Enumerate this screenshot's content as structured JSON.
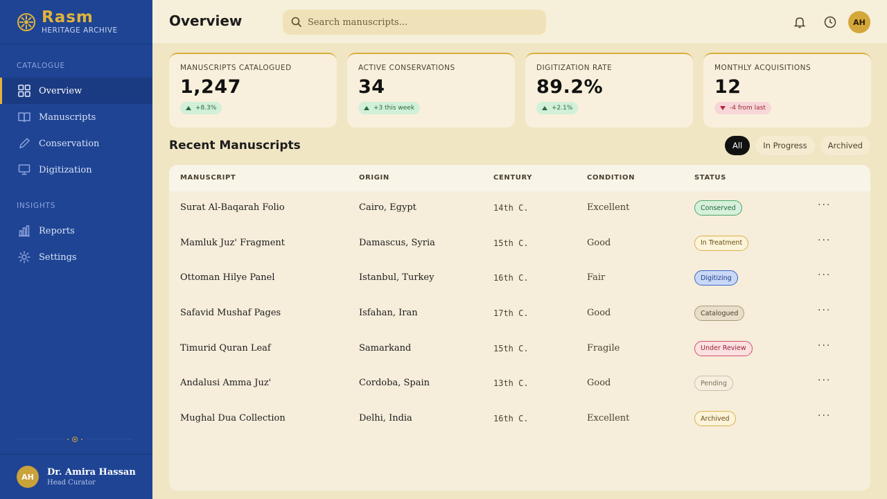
{
  "brand": {
    "name": "Rasm",
    "subtitle": "HERITAGE ARCHIVE"
  },
  "sidebar": {
    "sections": [
      {
        "label": "CATALOGUE",
        "items": [
          {
            "label": "Overview",
            "icon": "grid-icon",
            "active": true
          },
          {
            "label": "Manuscripts",
            "icon": "book-icon"
          },
          {
            "label": "Conservation",
            "icon": "pen-icon"
          },
          {
            "label": "Digitization",
            "icon": "monitor-icon"
          }
        ]
      },
      {
        "label": "INSIGHTS",
        "items": [
          {
            "label": "Reports",
            "icon": "bar-chart-icon"
          },
          {
            "label": "Settings",
            "icon": "gear-icon"
          }
        ]
      }
    ],
    "user": {
      "initials": "AH",
      "name": "Dr. Amira Hassan",
      "role": "Head Curator"
    }
  },
  "header": {
    "title": "Overview",
    "search_placeholder": "Search manuscripts...",
    "avatar_initials": "AH"
  },
  "stats": [
    {
      "label": "MANUSCRIPTS CATALOGUED",
      "value": "1,247",
      "delta": "+8.3%",
      "trend": "up"
    },
    {
      "label": "ACTIVE CONSERVATIONS",
      "value": "34",
      "delta": "+3 this week",
      "trend": "up"
    },
    {
      "label": "DIGITIZATION RATE",
      "value": "89.2%",
      "delta": "+2.1%",
      "trend": "up"
    },
    {
      "label": "MONTHLY ACQUISITIONS",
      "value": "12",
      "delta": "-4 from last",
      "trend": "down"
    }
  ],
  "recent": {
    "title": "Recent Manuscripts",
    "filters": [
      "All",
      "In Progress",
      "Archived"
    ],
    "active_filter": "All",
    "columns": [
      "MANUSCRIPT",
      "ORIGIN",
      "CENTURY",
      "CONDITION",
      "STATUS"
    ],
    "rows": [
      {
        "name": "Surat Al-Baqarah Folio",
        "origin": "Cairo, Egypt",
        "century": "14th C.",
        "condition": "Excellent",
        "status": "Conserved"
      },
      {
        "name": "Mamluk Juz' Fragment",
        "origin": "Damascus, Syria",
        "century": "15th C.",
        "condition": "Good",
        "status": "In Treatment"
      },
      {
        "name": "Ottoman Hilye Panel",
        "origin": "Istanbul, Turkey",
        "century": "16th C.",
        "condition": "Fair",
        "status": "Digitizing"
      },
      {
        "name": "Safavid Mushaf Pages",
        "origin": "Isfahan, Iran",
        "century": "17th C.",
        "condition": "Good",
        "status": "Catalogued"
      },
      {
        "name": "Timurid Quran Leaf",
        "origin": "Samarkand",
        "century": "15th C.",
        "condition": "Fragile",
        "status": "Under Review"
      },
      {
        "name": "Andalusi Amma Juz'",
        "origin": "Cordoba, Spain",
        "century": "13th C.",
        "condition": "Good",
        "status": "Pending"
      },
      {
        "name": "Mughal Dua Collection",
        "origin": "Delhi, India",
        "century": "16th C.",
        "condition": "Excellent",
        "status": "Archived"
      }
    ],
    "more_label": "···"
  },
  "colors": {
    "sidebar_bg": "#1f4494",
    "accent_gold": "#e0b43a",
    "page_bg": "#f0e6c4",
    "status": {
      "Conserved": {
        "bg": "#d6f0dc",
        "border": "#4aa867",
        "text": "#22683a"
      },
      "In Treatment": {
        "bg": "#fbf3da",
        "border": "#d9b24a",
        "text": "#6b4e12"
      },
      "Digitizing": {
        "bg": "#c9d8f6",
        "border": "#3b63c4",
        "text": "#1d3d8f"
      },
      "Catalogued": {
        "bg": "#e8dfc8",
        "border": "#a8997a",
        "text": "#4a3f2d"
      },
      "Under Review": {
        "bg": "#fbe1e1",
        "border": "#d4506a",
        "text": "#9a1f36"
      },
      "Pending": {
        "bg": "#f6efdf",
        "border": "#c9bfa8",
        "text": "#7a6e58"
      },
      "Archived": {
        "bg": "#fbf3da",
        "border": "#d9b24a",
        "text": "#6b4e12"
      }
    }
  }
}
